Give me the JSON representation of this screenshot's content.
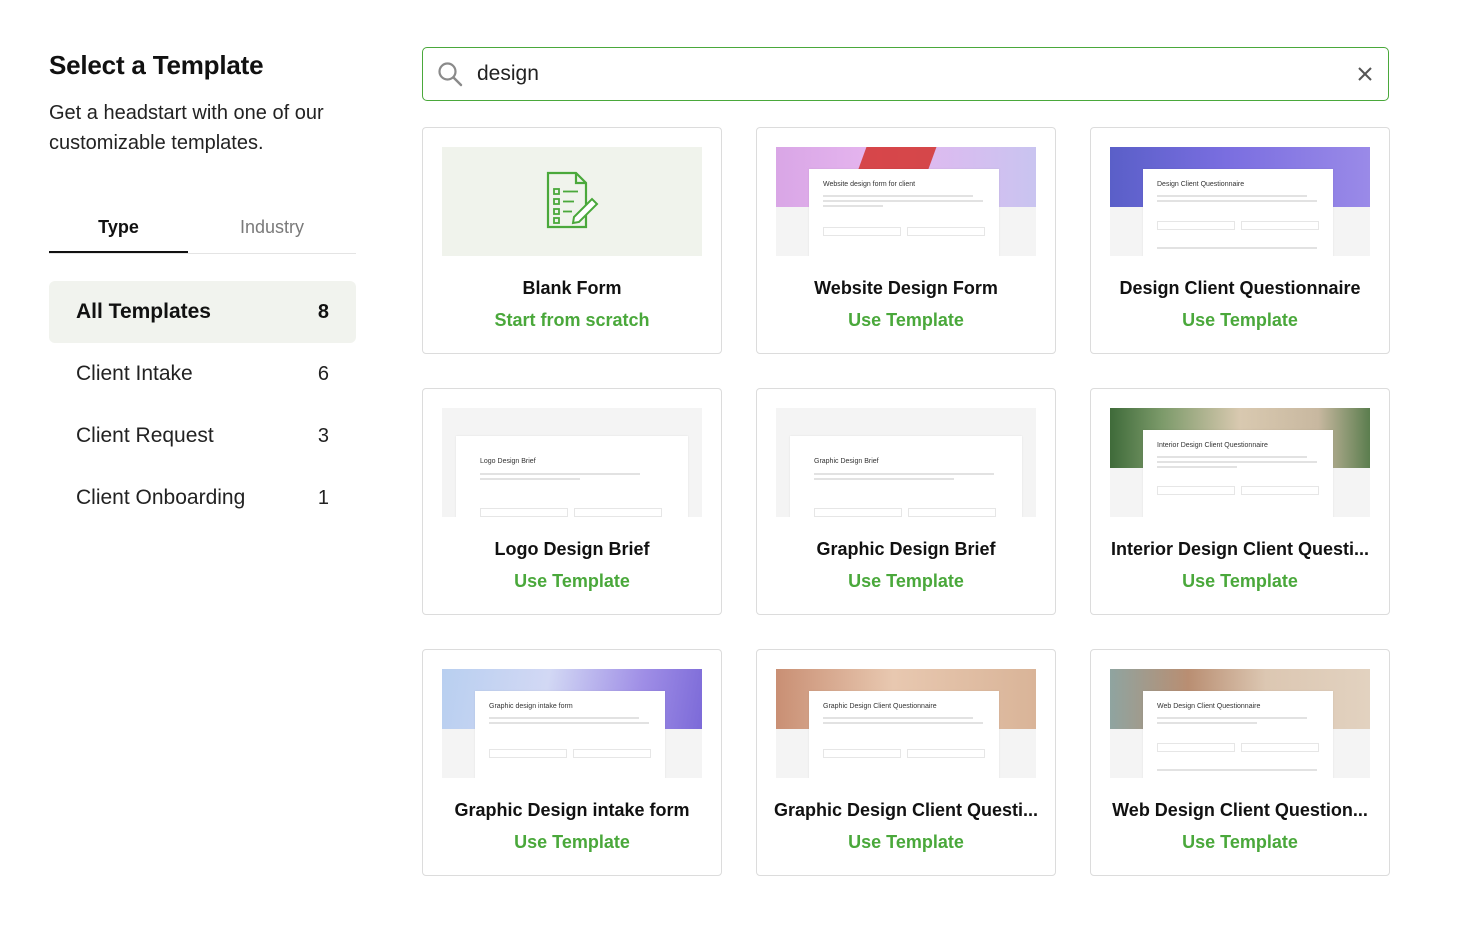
{
  "sidebar": {
    "title": "Select a Template",
    "subtitle": "Get a headstart with one of our customizable templates.",
    "tabs": [
      {
        "label": "Type",
        "active": true
      },
      {
        "label": "Industry",
        "active": false
      }
    ],
    "categories": [
      {
        "label": "All Templates",
        "count": "8",
        "active": true
      },
      {
        "label": "Client Intake",
        "count": "6",
        "active": false
      },
      {
        "label": "Client Request",
        "count": "3",
        "active": false
      },
      {
        "label": "Client Onboarding",
        "count": "1",
        "active": false
      }
    ]
  },
  "search": {
    "value": "design",
    "icon": "search-icon",
    "clear_icon": "close-icon"
  },
  "cards": [
    {
      "title": "Blank Form",
      "action": "Start from scratch"
    },
    {
      "title": "Website Design Form",
      "action": "Use Template",
      "preview_title": "Website design form for client"
    },
    {
      "title": "Design Client Questionnaire",
      "action": "Use Template",
      "preview_title": "Design Client Questionnaire"
    },
    {
      "title": "Logo Design Brief",
      "action": "Use Template",
      "preview_title": "Logo Design Brief"
    },
    {
      "title": "Graphic Design Brief",
      "action": "Use Template",
      "preview_title": "Graphic Design Brief"
    },
    {
      "title": "Interior Design Client Questi...",
      "action": "Use Template",
      "preview_title": "Interior Design Client Questionnaire"
    },
    {
      "title": "Graphic Design intake form",
      "action": "Use Template",
      "preview_title": "Graphic design intake form"
    },
    {
      "title": "Graphic Design Client Questi...",
      "action": "Use Template",
      "preview_title": "Graphic Design Client Questionnaire"
    },
    {
      "title": "Web Design Client Question...",
      "action": "Use Template",
      "preview_title": "Web Design Client Questionnaire"
    }
  ],
  "colors": {
    "accent": "#4aa83b",
    "active_bg": "#f1f3ee"
  }
}
